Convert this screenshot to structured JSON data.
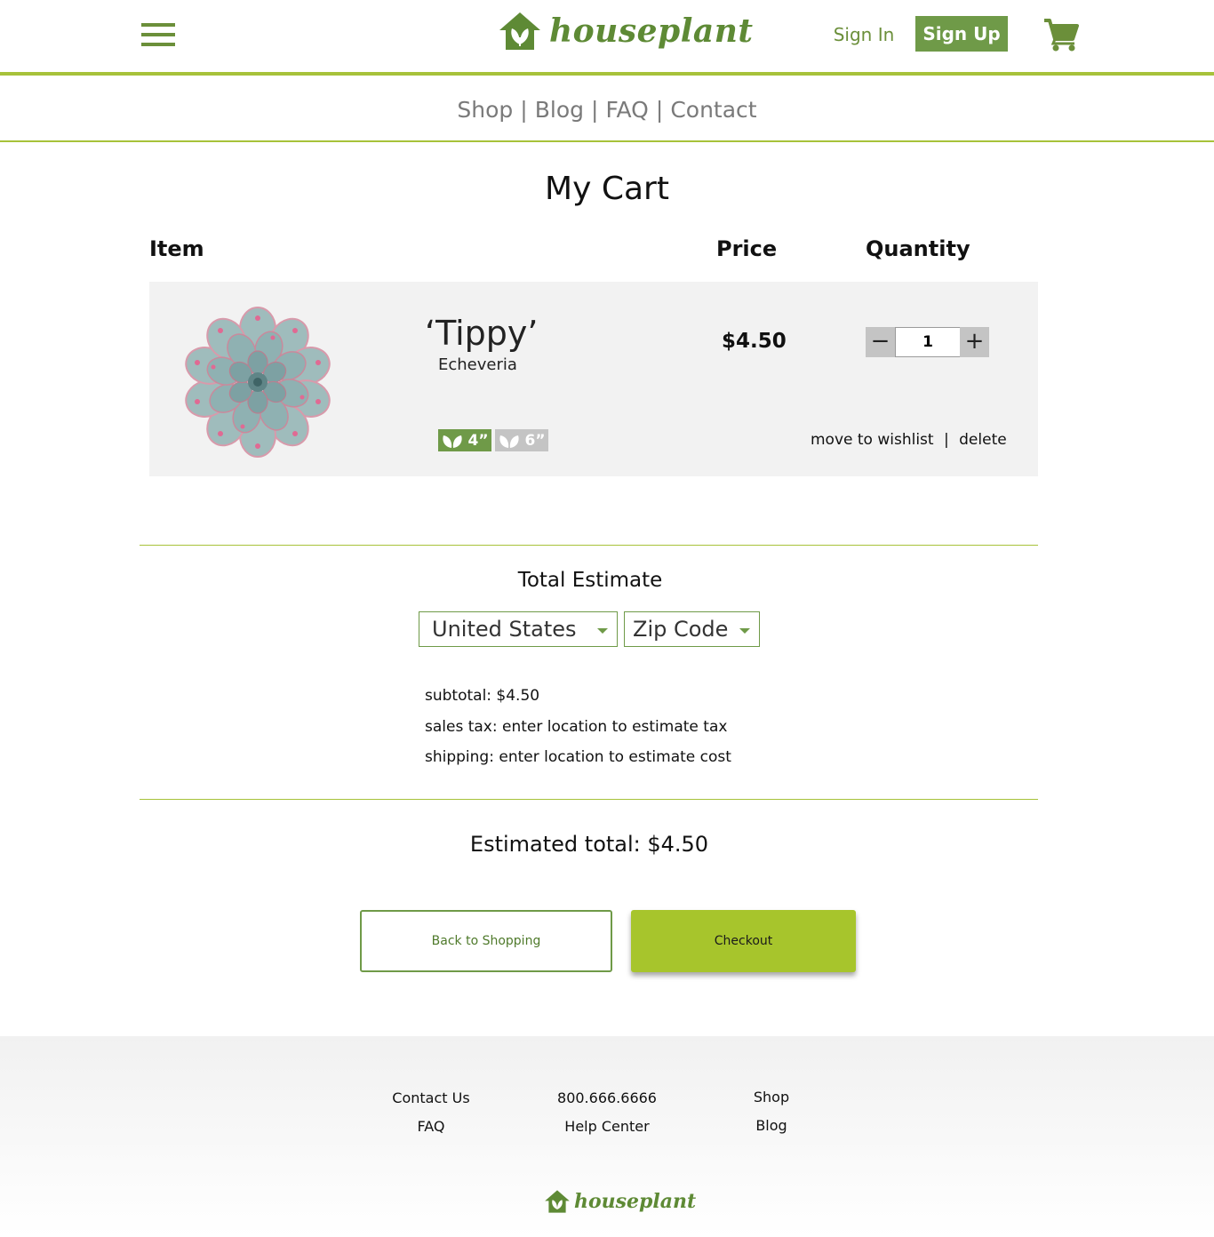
{
  "brand": {
    "name": "houseplant",
    "color": "#5e8a35",
    "accent": "#a7c23a"
  },
  "header": {
    "signin_label": "Sign In",
    "signup_label": "Sign Up"
  },
  "nav": {
    "items": [
      "Shop",
      "Blog",
      "FAQ",
      "Contact"
    ],
    "separator": "|"
  },
  "page": {
    "title": "My Cart"
  },
  "columns": {
    "item": "Item",
    "price": "Price",
    "quantity": "Quantity"
  },
  "cart_items": [
    {
      "name": "‘Tippy’",
      "type": "Echeveria",
      "price": "$4.50",
      "quantity": "1",
      "sizes": [
        {
          "label": "4”",
          "selected": true
        },
        {
          "label": "6”",
          "selected": false
        }
      ],
      "actions": {
        "wishlist": "move to wishlist",
        "separator": "|",
        "delete": "delete"
      }
    }
  ],
  "estimate": {
    "title": "Total Estimate",
    "country": "United States",
    "zip_placeholder": "Zip Code",
    "subtotal": "subtotal: $4.50",
    "sales_tax": "sales tax: enter location to estimate tax",
    "shipping": "shipping: enter location to estimate cost",
    "estimated_total": "Estimated total: $4.50"
  },
  "buttons": {
    "back": "Back to Shopping",
    "checkout": "Checkout"
  },
  "footer": {
    "col1": [
      "Contact Us",
      "FAQ"
    ],
    "col2": [
      "800.666.6666",
      "Help Center"
    ],
    "col3": [
      "Shop",
      "Blog"
    ]
  },
  "icons": {
    "menu": "hamburger-menu-icon",
    "cart": "shopping-cart-icon",
    "logo": "house-leaf-logo-icon",
    "leaf": "leaf-icon"
  }
}
